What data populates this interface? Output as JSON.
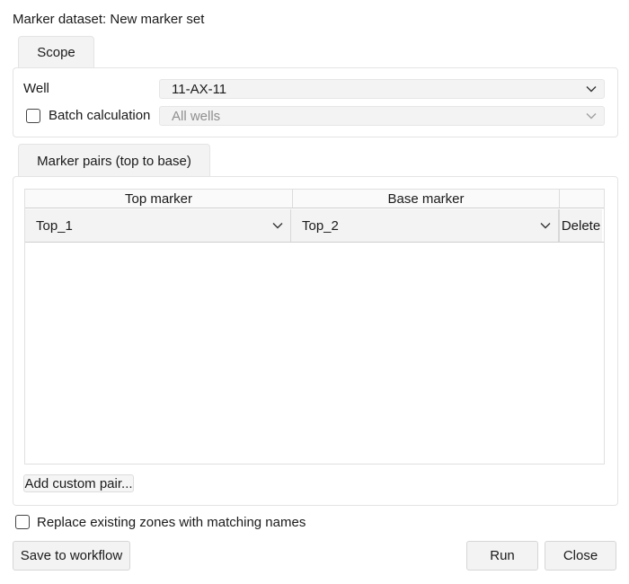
{
  "dataset_label": "Marker dataset: New marker set",
  "scope": {
    "tab_label": "Scope",
    "well_label": "Well",
    "well_value": "11-AX-11",
    "batch_label": "Batch calculation",
    "batch_checked": false,
    "batch_value": "All wells"
  },
  "pairs": {
    "tab_label": "Marker pairs (top to base)",
    "columns": [
      "Top marker",
      "Base marker",
      ""
    ],
    "rows": [
      {
        "top": "Top_1",
        "base": "Top_2",
        "action": "Delete"
      }
    ],
    "add_label": "Add custom pair..."
  },
  "replace_label": "Replace existing zones with matching names",
  "replace_checked": false,
  "buttons": {
    "save": "Save to workflow",
    "run": "Run",
    "close": "Close"
  }
}
